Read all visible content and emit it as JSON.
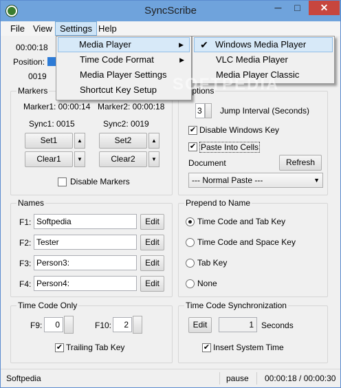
{
  "window": {
    "title": "SyncScribe",
    "minimize_label": "─",
    "maximize_label": "□",
    "close_label": "✕"
  },
  "menubar": {
    "items": [
      "File",
      "View",
      "Settings",
      "Help"
    ]
  },
  "top": {
    "time": "00:00:18",
    "position_label": "Position:",
    "count": "0019"
  },
  "markers": {
    "title": "Markers",
    "marker1": "Marker1: 00:00:14",
    "marker2": "Marker2: 00:00:18",
    "sync1": "Sync1: 0015",
    "sync2": "Sync2: 0019",
    "set1": "Set1",
    "set2": "Set2",
    "clear1": "Clear1",
    "clear2": "Clear2",
    "disable": "Disable Markers",
    "disable_checked": false,
    "up_glyph": "▲",
    "down_glyph": "▼"
  },
  "options": {
    "title": "Options",
    "jump_value": "3",
    "jump_label": "Jump Interval (Seconds)",
    "disable_windows_key": "Disable Windows Key",
    "disable_windows_key_checked": true,
    "paste_into_cells": "Paste Into Cells",
    "paste_into_cells_checked": true,
    "document_label": "Document",
    "refresh": "Refresh",
    "paste_mode": "--- Normal Paste ---"
  },
  "names": {
    "title": "Names",
    "rows": [
      {
        "key": "F1:",
        "value": "Softpedia",
        "button": "Edit"
      },
      {
        "key": "F2:",
        "value": "Tester",
        "button": "Edit"
      },
      {
        "key": "F3:",
        "value": "Person3:",
        "button": "Edit"
      },
      {
        "key": "F4:",
        "value": "Person4:",
        "button": "Edit"
      }
    ]
  },
  "prepend": {
    "title": "Prepend to Name",
    "options": [
      {
        "label": "Time Code and Tab Key",
        "selected": true
      },
      {
        "label": "Time Code and Space Key",
        "selected": false
      },
      {
        "label": "Tab Key",
        "selected": false
      },
      {
        "label": "None",
        "selected": false
      }
    ]
  },
  "timecode_only": {
    "title": "Time Code Only",
    "f9_label": "F9:",
    "f9_value": "0",
    "f10_label": "F10:",
    "f10_value": "2",
    "trailing_tab": "Trailing Tab Key",
    "trailing_tab_checked": true
  },
  "sync": {
    "title": "Time Code Synchronization",
    "edit": "Edit",
    "seconds_value": "1",
    "seconds_label": "Seconds",
    "insert_system_time": "Insert System Time",
    "insert_system_time_checked": true
  },
  "statusbar": {
    "left": "Softpedia",
    "state": "pause",
    "time": "00:00:18 / 00:00:30"
  },
  "settings_menu": {
    "items": [
      {
        "label": "Media Player",
        "submenu": true
      },
      {
        "label": "Time Code Format",
        "submenu": true
      },
      {
        "label": "Media Player Settings",
        "submenu": false
      },
      {
        "label": "Shortcut Key Setup",
        "submenu": false
      }
    ],
    "submenu_glyph": "▶"
  },
  "player_submenu": {
    "items": [
      {
        "label": "Windows Media Player",
        "checked": true
      },
      {
        "label": "VLC Media Player",
        "checked": false
      },
      {
        "label": "Media Player Classic",
        "checked": false
      }
    ],
    "check_glyph": "✔"
  },
  "watermark": "SOFTPEDIA",
  "glyphs": {
    "check": "✔",
    "dropdown_arrow": "▼"
  },
  "colors": {
    "titlebar": "#6fa3dc",
    "close": "#c7463e",
    "menu_highlight": "#d7e9f8",
    "progress": "#2d7bd6"
  }
}
